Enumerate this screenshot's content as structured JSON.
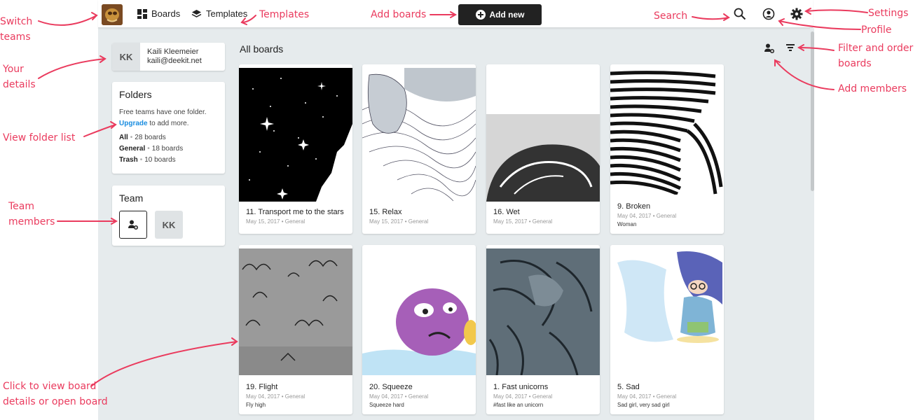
{
  "nav": {
    "boards_label": "Boards",
    "templates_label": "Templates",
    "add_new_label": "Add new"
  },
  "user": {
    "initials": "KK",
    "name": "Kaili Kleemeier",
    "email": "kaili@deekit.net"
  },
  "folders": {
    "title": "Folders",
    "note": "Free teams have one folder.",
    "upgrade_link": "Upgrade",
    "upgrade_rest": "to add more.",
    "items": [
      {
        "name": "All",
        "count": "28 boards"
      },
      {
        "name": "General",
        "count": "18 boards"
      },
      {
        "name": "Trash",
        "count": "10 boards"
      }
    ]
  },
  "team": {
    "title": "Team",
    "member_initials": "KK"
  },
  "main": {
    "title": "All boards"
  },
  "boards": [
    {
      "title": "11. Transport me to the stars",
      "date": "May 15, 2017",
      "folder": "General",
      "desc": ""
    },
    {
      "title": "15. Relax",
      "date": "May 15, 2017",
      "folder": "General",
      "desc": ""
    },
    {
      "title": "16. Wet",
      "date": "May 15, 2017",
      "folder": "General",
      "desc": ""
    },
    {
      "title": "9. Broken",
      "date": "May 04, 2017",
      "folder": "General",
      "desc": "Woman"
    },
    {
      "title": "19. Flight",
      "date": "May 04, 2017",
      "folder": "General",
      "desc": "Fly high"
    },
    {
      "title": "20. Squeeze",
      "date": "May 04, 2017",
      "folder": "General",
      "desc": "Squeeze hard"
    },
    {
      "title": "1. Fast unicorns",
      "date": "May 04, 2017",
      "folder": "General",
      "desc": "#fast like an unicorn"
    },
    {
      "title": "5. Sad",
      "date": "May 04, 2017",
      "folder": "General",
      "desc": "Sad girl, very sad girl"
    }
  ],
  "annotations": {
    "switch_teams": "Switch teams",
    "your_details": "Your details",
    "view_folder_list": "View folder list",
    "team_members": "Team members",
    "click_board": "Click to view board details or open board",
    "templates": "Templates",
    "add_boards": "Add boards",
    "search": "Search",
    "settings": "Settings",
    "profile": "Profile",
    "filter_order": "Filter and order boards",
    "add_members": "Add members"
  },
  "colors": {
    "annotation": "#ea3b5e",
    "link": "#1a8de0",
    "background": "#e6ebed"
  }
}
